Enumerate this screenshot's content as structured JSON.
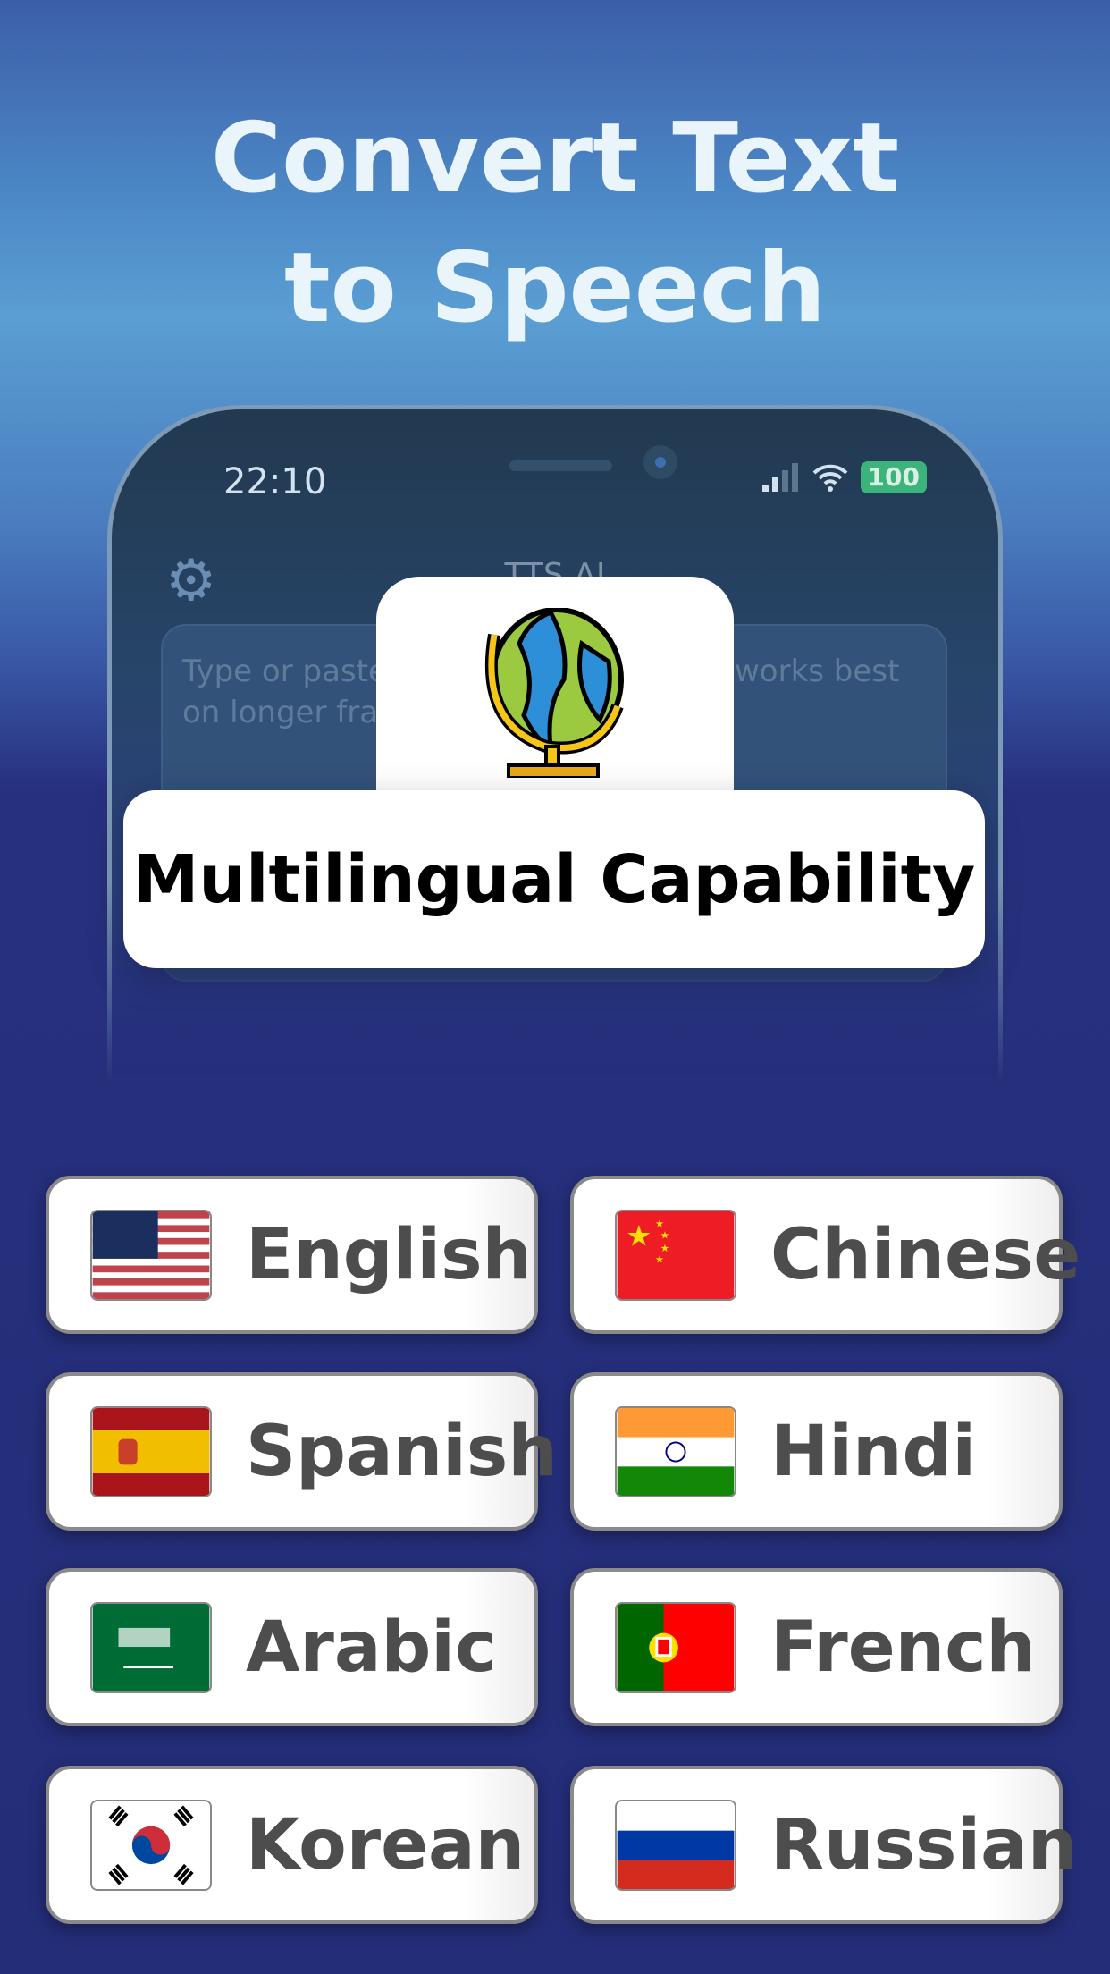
{
  "headline": {
    "line1": "Convert Text",
    "line2": "to Speech"
  },
  "phone": {
    "status_time": "22:10",
    "battery": "100",
    "app_title": "TTS AI",
    "placeholder_fragments": [
      "Type or paste",
      "works best",
      "on longer fra"
    ],
    "icons": [
      "gear-icon",
      "signal-icon",
      "wifi-icon",
      "battery-icon"
    ]
  },
  "feature": {
    "icon": "globe-icon",
    "label": "Multilingual Capability"
  },
  "languages": [
    {
      "label": "English",
      "flag": "us"
    },
    {
      "label": "Chinese",
      "flag": "cn"
    },
    {
      "label": "Spanish",
      "flag": "es"
    },
    {
      "label": "Hindi",
      "flag": "in"
    },
    {
      "label": "Arabic",
      "flag": "sa"
    },
    {
      "label": "French",
      "flag": "pt"
    },
    {
      "label": "Korean",
      "flag": "kr"
    },
    {
      "label": "Russian",
      "flag": "ru"
    }
  ],
  "colors": {
    "background_top": "#3c5ea8",
    "background_bottom": "#242d78",
    "label_text": "#4d4d4d",
    "battery": "#3cb37a"
  }
}
